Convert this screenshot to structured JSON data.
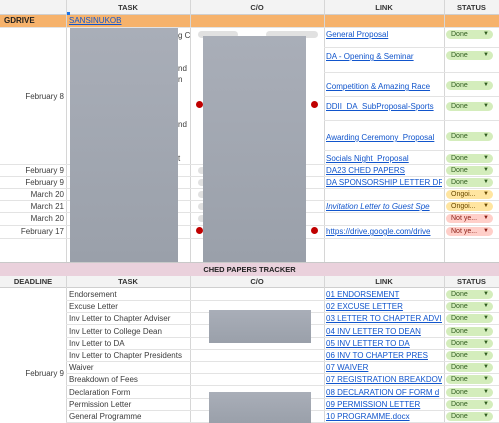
{
  "headers": {
    "task": "TASK",
    "co": "C/O",
    "link": "LINK",
    "status": "STATUS"
  },
  "gdrive": {
    "label": "GDRIVE",
    "link": "SANSINUKOB"
  },
  "section1": {
    "partial_task_texts": [
      "g Co",
      "nd",
      "n",
      "nd",
      "t"
    ],
    "dates": {
      "feb8": "February 8",
      "feb9a": "February 9",
      "feb9b": "February 9",
      "mar20a": "March 20",
      "mar21": "March 21",
      "mar20b": "March 20",
      "feb17": "February 17"
    },
    "links": [
      "General Proposal",
      "DA - Opening & Seminar",
      "Competition & Amazing Race",
      "DDII_DA_SubProposal-Sports",
      "Awarding Ceremony_Proposal",
      "Socials Night_Proposal",
      "DA23 CHED PAPERS",
      "DA SPONSORSHIP LETTER DR",
      "",
      "Invitation Letter to Guest Spe",
      "",
      "https://drive.google.com/drive"
    ],
    "statuses": [
      "Done",
      "Done",
      "Done",
      "Done",
      "Done",
      "Done",
      "Done",
      "Done",
      "Ongoi...",
      "Ongoi...",
      "Not ye...",
      "Not ye..."
    ]
  },
  "tracker": {
    "title": "CHED PAPERS TRACKER",
    "headers": {
      "deadline": "DEADLINE",
      "task": "TASK",
      "co": "C/O",
      "link": "LINK",
      "status": "STATUS"
    },
    "deadline": "February 9",
    "rows": [
      {
        "task": "Endorsement",
        "link": "01 ENDORSEMENT",
        "status": "Done"
      },
      {
        "task": "Excuse Letter",
        "link": "02 EXCUSE LETTER",
        "status": "Done"
      },
      {
        "task": "Inv Letter to Chapter Adviser",
        "link": "03 LETTER TO CHAPTER ADVIS",
        "status": "Done"
      },
      {
        "task": "Inv Letter to College Dean",
        "link": "04 INV LETTER TO DEAN",
        "status": "Done"
      },
      {
        "task": "Inv Letter to DA",
        "link": "05 INV LETTER TO DA",
        "status": "Done"
      },
      {
        "task": "Inv Letter to Chapter Presidents",
        "link": "06 INV TO CHAPTER PRES",
        "status": "Done"
      },
      {
        "task": "Waiver",
        "link": "07 WAIVER",
        "status": "Done"
      },
      {
        "task": "Breakdown of Fees",
        "link": "07 REGISTRATION BREAKDOW",
        "status": "Done"
      },
      {
        "task": "Declaration Form",
        "link": "08 DECLARATION OF FORM d",
        "status": "Done"
      },
      {
        "task": "Permission Letter",
        "link": "09 PERMISSION LETTER",
        "status": "Done"
      },
      {
        "task": "General Programme",
        "link": "10 PROGRAMME.docx",
        "status": "Done"
      }
    ]
  },
  "icons": {
    "dropdown": "chevron-down-icon"
  },
  "colors": {
    "gdrive_band": "#f6b26b",
    "tracker_band": "#ead1dc",
    "done": "#d4edbc",
    "ongoing": "#ffe5a0",
    "not_yet": "#ffcfc9",
    "link": "#1155cc"
  }
}
